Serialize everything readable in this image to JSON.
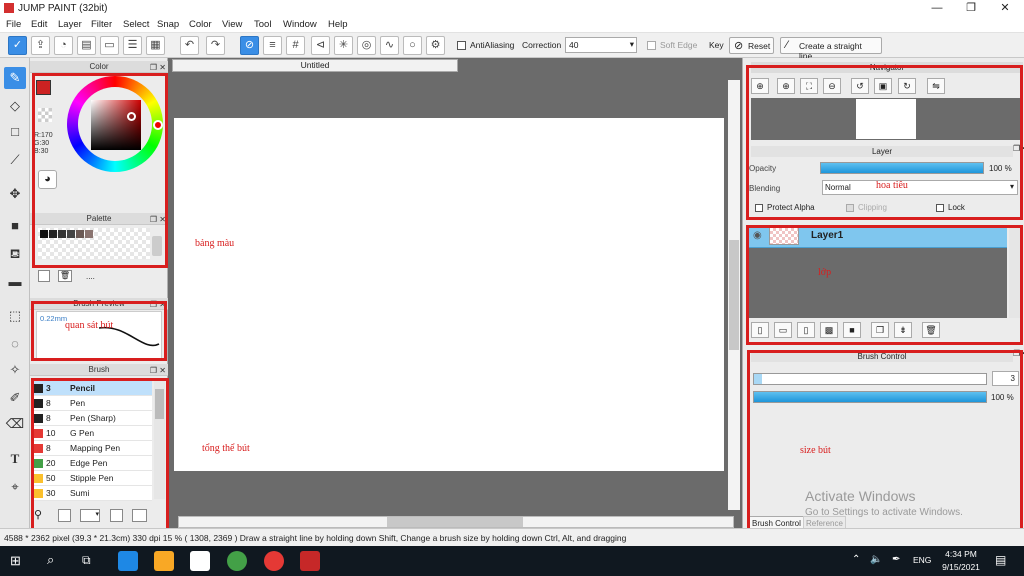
{
  "window": {
    "title": "JUMP PAINT (32bit)",
    "minimize": "—",
    "maximize": "❐",
    "close": "✕"
  },
  "menu": [
    "File",
    "Edit",
    "Layer",
    "Filter",
    "Select",
    "Snap",
    "Color",
    "View",
    "Tool",
    "Window",
    "Help"
  ],
  "toolbar": {
    "antialiasing": "AntiAliasing",
    "correction_label": "Correction",
    "correction_value": "40",
    "soft_edge": "Soft Edge",
    "key_label": "Key",
    "reset_label": "Reset",
    "straight_line_label": "Create a straight line"
  },
  "color_panel": {
    "title": "Color",
    "r": "R:170",
    "g": "G:30",
    "b": "B:30",
    "main_color": "#cc2222",
    "sub_color": "#f4e2c8"
  },
  "palette_panel": {
    "title": "Palette",
    "more": "....",
    "swatches": [
      "#111111",
      "#222222",
      "#333333",
      "#444444",
      "#6b5a55",
      "#8a7470"
    ]
  },
  "brush_preview": {
    "title": "Brush Preview",
    "size": "0.22mm"
  },
  "brush_panel": {
    "title": "Brush",
    "items": [
      {
        "size": "3",
        "name": "Pencil",
        "color": "#222222",
        "selected": true
      },
      {
        "size": "8",
        "name": "Pen",
        "color": "#222222"
      },
      {
        "size": "8",
        "name": "Pen (Sharp)",
        "color": "#222222"
      },
      {
        "size": "10",
        "name": "G Pen",
        "color": "#e53935"
      },
      {
        "size": "8",
        "name": "Mapping Pen",
        "color": "#e53935"
      },
      {
        "size": "20",
        "name": "Edge Pen",
        "color": "#43a047"
      },
      {
        "size": "50",
        "name": "Stipple Pen",
        "color": "#fbc02d"
      },
      {
        "size": "30",
        "name": "Sumi",
        "color": "#fbc02d"
      }
    ]
  },
  "document": {
    "tab": "Untitled"
  },
  "navigator": {
    "title": "Navigator"
  },
  "layer_panel": {
    "title": "Layer",
    "opacity_label": "Opacity",
    "opacity_value": "100 %",
    "opacity_fraction": 1.0,
    "blending_label": "Blending",
    "blending_value": "Normal",
    "protect_alpha": "Protect Alpha",
    "clipping": "Clipping",
    "lock": "Lock",
    "layers": [
      {
        "name": "Layer1"
      }
    ]
  },
  "brush_control": {
    "title": "Brush Control",
    "size_value": "3",
    "opacity_value": "100 %",
    "opacity_fraction": 1.0,
    "tab_brush": "Brush Control",
    "tab_reference": "Reference"
  },
  "annotations": {
    "palette_note": "bảng màu",
    "preview_note": "quan sát bút",
    "brush_note": "tổng thể bút",
    "nav_note": "hoa tiêu",
    "layer_note": "lớp",
    "size_note": "size bút",
    "accent": "#d81e1e"
  },
  "watermark": {
    "line1": "Activate Windows",
    "line2": "Go to Settings to activate Windows."
  },
  "status": {
    "text": "4588 * 2362 pixel  (39.3 * 21.3cm)  330 dpi   15 %   ( 1308, 2369 )   Draw a straight line by holding down Shift, Change a brush size by holding down Ctrl, Alt, and dragging"
  },
  "taskbar": {
    "lang": "ENG",
    "time": "4:34 PM",
    "date": "9/15/2021"
  }
}
